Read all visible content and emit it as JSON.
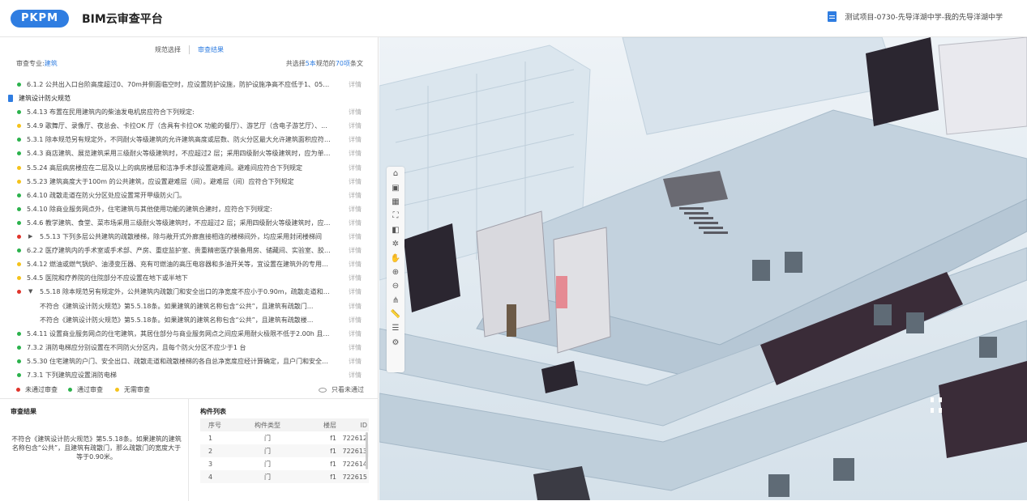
{
  "header": {
    "logo": "PKPM",
    "title": "BIM云审查平台",
    "project": "测试项目-0730-先导洋湖中学-我的先导洋湖中学"
  },
  "tabs": [
    "规范选择",
    "审查结果"
  ],
  "subhead": {
    "major_label": "审查专业:",
    "major_value": "建筑",
    "summary_pre": "共选择",
    "summary_count": "5本",
    "summary_mid": "规范的",
    "summary_items": "70项",
    "summary_post": "条文"
  },
  "rules": [
    {
      "status": "green",
      "text": "6.1.2 公共出入口台阶高度超过0、70m并侧面临空时，应设置防护设施，防护设施净高不应低于1、05m。",
      "detail": "详情"
    },
    {
      "status": "category",
      "text": "建筑设计防火规范",
      "detail": ""
    },
    {
      "status": "green",
      "text": "5.4.13 布置在民用建筑内的柴油发电机房应符合下列规定:",
      "detail": "详情"
    },
    {
      "status": "yellow",
      "text": "5.4.9 歌舞厅、录像厅、夜总会、卡拉OK 厅（含具有卡拉OK 功能的餐厅）、游艺厅（含电子游艺厅）、...",
      "detail": "详情"
    },
    {
      "status": "green",
      "text": "5.3.1 除本规范另有规定外，不同耐火等级建筑的允许建筑高度或层数、防火分区最大允许建筑面积应符合...",
      "detail": "详情"
    },
    {
      "status": "green",
      "text": "5.4.3 商店建筑、展览建筑采用三级耐火等级建筑时，不应超过2 层；采用四级耐火等级建筑时，应为单层...",
      "detail": "详情"
    },
    {
      "status": "yellow",
      "text": "5.5.24 高层病房楼应在二层及以上的病房楼层和洁净手术部设置避难间。避难间应符合下列规定",
      "detail": "详情"
    },
    {
      "status": "yellow",
      "text": "5.5.23 建筑高度大于100m 的公共建筑，应设置避难层（间）。避难层（间）应符合下列规定",
      "detail": "详情"
    },
    {
      "status": "green",
      "text": "6.4.10 疏散走道在防火分区处应设置常开甲级防火门。",
      "detail": "详情"
    },
    {
      "status": "green",
      "text": "5.4.10 除商业服务网点外，住宅建筑与其他使用功能的建筑合建时，应符合下列规定:",
      "detail": "详情"
    },
    {
      "status": "green",
      "text": "5.4.6 教学建筑、食堂、菜市场采用三级耐火等级建筑时，不应超过2 层；采用四级耐火等级建筑时，应为...",
      "detail": "详情"
    },
    {
      "status": "red",
      "arrow": "▶",
      "text": "5.5.13 下列多层公共建筑的疏散楼梯，除与敞开式外廊直接相连的楼梯间外，均应采用封闭楼梯间",
      "detail": "详情"
    },
    {
      "status": "green",
      "text": "6.2.2 医疗建筑内的手术室或手术部、产房、重症监护室、贵重精密医疗装备用房、储藏间、实验室、胶片...",
      "detail": "详情"
    },
    {
      "status": "yellow",
      "text": "5.4.12 燃油或燃气锅炉、油浸变压器、充有可燃油的高压电容器和多油开关等，宜设置在建筑外的专用房...",
      "detail": "详情"
    },
    {
      "status": "yellow",
      "text": "5.4.5 医院和疗养院的住院部分不应设置在地下或半地下",
      "detail": "详情"
    },
    {
      "status": "red",
      "arrow": "▼",
      "text": "5.5.18 除本规范另有规定外，公共建筑内疏散门和安全出口的净宽度不应小于0.90m，疏散走道和疏...",
      "detail": "详情"
    },
    {
      "status": "sub",
      "text": "不符合《建筑设计防火规范》第5.5.18条。如果建筑的建筑名称包含“公共”，且建筑有疏散门...",
      "detail": "详情"
    },
    {
      "status": "sub",
      "text": "不符合《建筑设计防火规范》第5.5.18条。如果建筑的建筑名称包含“公共”，且建筑有疏散楼...",
      "detail": "详情"
    },
    {
      "status": "green",
      "text": "5.4.11 设置商业服务网点的住宅建筑，其居住部分与商业服务网点之间应采用耐火极限不低于2.00h 且无...",
      "detail": "详情"
    },
    {
      "status": "green",
      "text": "7.3.2 消防电梯应分别设置在不同防火分区内，且每个防火分区不应少于1 台",
      "detail": "详情"
    },
    {
      "status": "green",
      "text": "5.5.30 住宅建筑的户门、安全出口、疏散走道和疏散楼梯的各自总净宽度应经计算确定，且户门和安全出...",
      "detail": "详情"
    },
    {
      "status": "green",
      "text": "7.3.1 下列建筑应设置消防电梯",
      "detail": "详情"
    }
  ],
  "legend": {
    "fail": "未通过审查",
    "pass": "通过审查",
    "none": "无需审查",
    "only_fail": "只看未通过"
  },
  "result": {
    "title": "审查结果",
    "text": "不符合《建筑设计防火规范》第5.5.18条。如果建筑的建筑名称包含“公共”，且建筑有疏散门，那么疏散门的宽度大于等于0.90米。"
  },
  "components": {
    "title": "构件列表",
    "headers": [
      "序号",
      "构件类型",
      "楼层",
      "ID"
    ],
    "rows": [
      [
        "1",
        "门",
        "f1",
        "722612"
      ],
      [
        "2",
        "门",
        "f1",
        "722613"
      ],
      [
        "3",
        "门",
        "f1",
        "722614"
      ],
      [
        "4",
        "门",
        "f1",
        "722615"
      ]
    ]
  },
  "toolbar": [
    "home-icon",
    "cube-icon",
    "grid-icon",
    "fit-icon",
    "section-icon",
    "orbit-icon",
    "pan-icon",
    "zoom-in-icon",
    "zoom-out-icon",
    "tree-icon",
    "measure-icon",
    "layers-icon",
    "settings-icon"
  ],
  "colors": {
    "accent": "#2f7de1",
    "pass": "#2bb24c",
    "none": "#f5c31b",
    "fail": "#e0342b"
  }
}
